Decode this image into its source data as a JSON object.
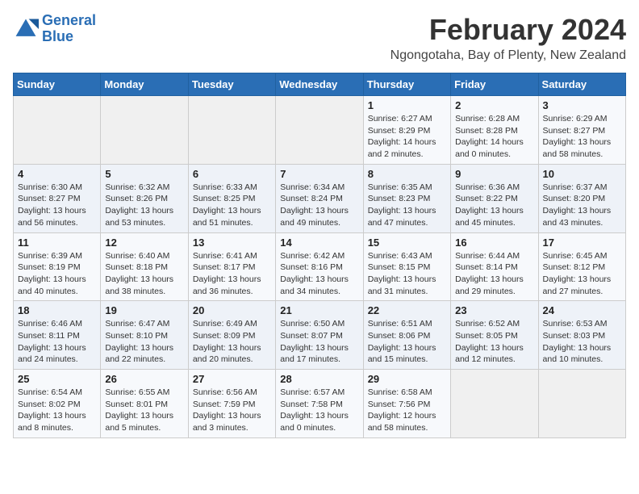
{
  "header": {
    "logo_line1": "General",
    "logo_line2": "Blue",
    "title": "February 2024",
    "subtitle": "Ngongotaha, Bay of Plenty, New Zealand"
  },
  "weekdays": [
    "Sunday",
    "Monday",
    "Tuesday",
    "Wednesday",
    "Thursday",
    "Friday",
    "Saturday"
  ],
  "weeks": [
    [
      {
        "day": "",
        "info": ""
      },
      {
        "day": "",
        "info": ""
      },
      {
        "day": "",
        "info": ""
      },
      {
        "day": "",
        "info": ""
      },
      {
        "day": "1",
        "info": "Sunrise: 6:27 AM\nSunset: 8:29 PM\nDaylight: 14 hours\nand 2 minutes."
      },
      {
        "day": "2",
        "info": "Sunrise: 6:28 AM\nSunset: 8:28 PM\nDaylight: 14 hours\nand 0 minutes."
      },
      {
        "day": "3",
        "info": "Sunrise: 6:29 AM\nSunset: 8:27 PM\nDaylight: 13 hours\nand 58 minutes."
      }
    ],
    [
      {
        "day": "4",
        "info": "Sunrise: 6:30 AM\nSunset: 8:27 PM\nDaylight: 13 hours\nand 56 minutes."
      },
      {
        "day": "5",
        "info": "Sunrise: 6:32 AM\nSunset: 8:26 PM\nDaylight: 13 hours\nand 53 minutes."
      },
      {
        "day": "6",
        "info": "Sunrise: 6:33 AM\nSunset: 8:25 PM\nDaylight: 13 hours\nand 51 minutes."
      },
      {
        "day": "7",
        "info": "Sunrise: 6:34 AM\nSunset: 8:24 PM\nDaylight: 13 hours\nand 49 minutes."
      },
      {
        "day": "8",
        "info": "Sunrise: 6:35 AM\nSunset: 8:23 PM\nDaylight: 13 hours\nand 47 minutes."
      },
      {
        "day": "9",
        "info": "Sunrise: 6:36 AM\nSunset: 8:22 PM\nDaylight: 13 hours\nand 45 minutes."
      },
      {
        "day": "10",
        "info": "Sunrise: 6:37 AM\nSunset: 8:20 PM\nDaylight: 13 hours\nand 43 minutes."
      }
    ],
    [
      {
        "day": "11",
        "info": "Sunrise: 6:39 AM\nSunset: 8:19 PM\nDaylight: 13 hours\nand 40 minutes."
      },
      {
        "day": "12",
        "info": "Sunrise: 6:40 AM\nSunset: 8:18 PM\nDaylight: 13 hours\nand 38 minutes."
      },
      {
        "day": "13",
        "info": "Sunrise: 6:41 AM\nSunset: 8:17 PM\nDaylight: 13 hours\nand 36 minutes."
      },
      {
        "day": "14",
        "info": "Sunrise: 6:42 AM\nSunset: 8:16 PM\nDaylight: 13 hours\nand 34 minutes."
      },
      {
        "day": "15",
        "info": "Sunrise: 6:43 AM\nSunset: 8:15 PM\nDaylight: 13 hours\nand 31 minutes."
      },
      {
        "day": "16",
        "info": "Sunrise: 6:44 AM\nSunset: 8:14 PM\nDaylight: 13 hours\nand 29 minutes."
      },
      {
        "day": "17",
        "info": "Sunrise: 6:45 AM\nSunset: 8:12 PM\nDaylight: 13 hours\nand 27 minutes."
      }
    ],
    [
      {
        "day": "18",
        "info": "Sunrise: 6:46 AM\nSunset: 8:11 PM\nDaylight: 13 hours\nand 24 minutes."
      },
      {
        "day": "19",
        "info": "Sunrise: 6:47 AM\nSunset: 8:10 PM\nDaylight: 13 hours\nand 22 minutes."
      },
      {
        "day": "20",
        "info": "Sunrise: 6:49 AM\nSunset: 8:09 PM\nDaylight: 13 hours\nand 20 minutes."
      },
      {
        "day": "21",
        "info": "Sunrise: 6:50 AM\nSunset: 8:07 PM\nDaylight: 13 hours\nand 17 minutes."
      },
      {
        "day": "22",
        "info": "Sunrise: 6:51 AM\nSunset: 8:06 PM\nDaylight: 13 hours\nand 15 minutes."
      },
      {
        "day": "23",
        "info": "Sunrise: 6:52 AM\nSunset: 8:05 PM\nDaylight: 13 hours\nand 12 minutes."
      },
      {
        "day": "24",
        "info": "Sunrise: 6:53 AM\nSunset: 8:03 PM\nDaylight: 13 hours\nand 10 minutes."
      }
    ],
    [
      {
        "day": "25",
        "info": "Sunrise: 6:54 AM\nSunset: 8:02 PM\nDaylight: 13 hours\nand 8 minutes."
      },
      {
        "day": "26",
        "info": "Sunrise: 6:55 AM\nSunset: 8:01 PM\nDaylight: 13 hours\nand 5 minutes."
      },
      {
        "day": "27",
        "info": "Sunrise: 6:56 AM\nSunset: 7:59 PM\nDaylight: 13 hours\nand 3 minutes."
      },
      {
        "day": "28",
        "info": "Sunrise: 6:57 AM\nSunset: 7:58 PM\nDaylight: 13 hours\nand 0 minutes."
      },
      {
        "day": "29",
        "info": "Sunrise: 6:58 AM\nSunset: 7:56 PM\nDaylight: 12 hours\nand 58 minutes."
      },
      {
        "day": "",
        "info": ""
      },
      {
        "day": "",
        "info": ""
      }
    ]
  ]
}
